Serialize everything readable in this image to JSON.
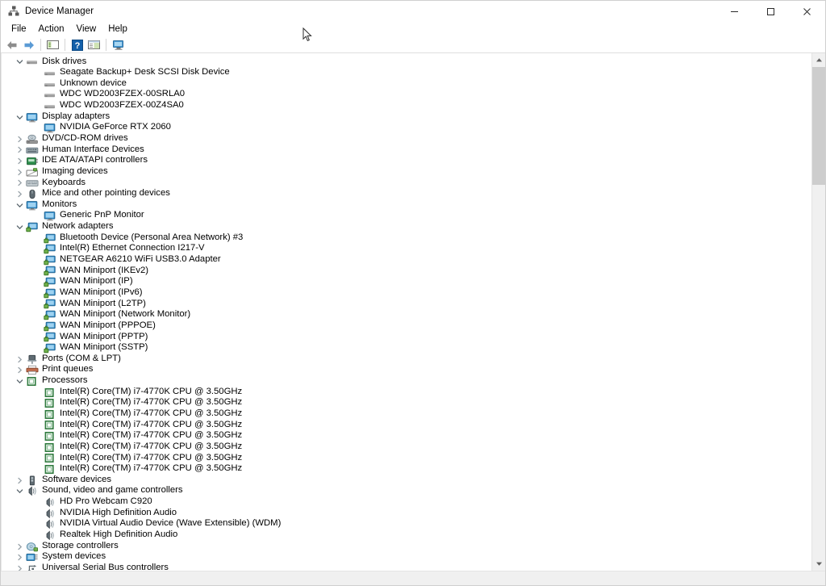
{
  "window": {
    "title": "Device Manager",
    "app_icon": "device-manager-icon",
    "controls": {
      "minimize": "─",
      "maximize": "☐",
      "close": "✕"
    }
  },
  "menubar": {
    "items": [
      {
        "label": "File"
      },
      {
        "label": "Action"
      },
      {
        "label": "View"
      },
      {
        "label": "Help"
      }
    ]
  },
  "toolbar": {
    "buttons": [
      {
        "name": "back-arrow-icon",
        "tooltip": "Back"
      },
      {
        "name": "forward-arrow-icon",
        "tooltip": "Forward"
      },
      {
        "name": "separator-1"
      },
      {
        "name": "show-hide-console-tree-icon",
        "tooltip": "Show/Hide Console Tree"
      },
      {
        "name": "separator-2"
      },
      {
        "name": "help-icon",
        "tooltip": "Help"
      },
      {
        "name": "properties-icon",
        "tooltip": "Properties"
      },
      {
        "name": "separator-3"
      },
      {
        "name": "scan-for-hardware-changes-icon",
        "tooltip": "Scan for hardware changes"
      }
    ]
  },
  "scrollbar": {
    "up_arrow": "▲",
    "down_arrow": "▼",
    "thumb_top_pct": 0,
    "thumb_height_pct": 24
  },
  "tree": [
    {
      "depth": 0,
      "state": "expanded",
      "icon": "disk-drive-icon",
      "label": "Disk drives"
    },
    {
      "depth": 1,
      "state": "leaf",
      "icon": "disk-drive-icon",
      "label": "Seagate Backup+  Desk SCSI Disk Device"
    },
    {
      "depth": 1,
      "state": "leaf",
      "icon": "disk-drive-icon",
      "label": "Unknown device"
    },
    {
      "depth": 1,
      "state": "leaf",
      "icon": "disk-drive-icon",
      "label": "WDC WD2003FZEX-00SRLA0"
    },
    {
      "depth": 1,
      "state": "leaf",
      "icon": "disk-drive-icon",
      "label": "WDC WD2003FZEX-00Z4SA0"
    },
    {
      "depth": 0,
      "state": "expanded",
      "icon": "display-adapter-icon",
      "label": "Display adapters"
    },
    {
      "depth": 1,
      "state": "leaf",
      "icon": "display-adapter-icon",
      "label": "NVIDIA GeForce RTX 2060"
    },
    {
      "depth": 0,
      "state": "collapsed",
      "icon": "dvd-drive-icon",
      "label": "DVD/CD-ROM drives"
    },
    {
      "depth": 0,
      "state": "collapsed",
      "icon": "hid-icon",
      "label": "Human Interface Devices"
    },
    {
      "depth": 0,
      "state": "collapsed",
      "icon": "ide-controller-icon",
      "label": "IDE ATA/ATAPI controllers"
    },
    {
      "depth": 0,
      "state": "collapsed",
      "icon": "imaging-device-icon",
      "label": "Imaging devices"
    },
    {
      "depth": 0,
      "state": "collapsed",
      "icon": "keyboard-icon",
      "label": "Keyboards"
    },
    {
      "depth": 0,
      "state": "collapsed",
      "icon": "mouse-icon",
      "label": "Mice and other pointing devices"
    },
    {
      "depth": 0,
      "state": "expanded",
      "icon": "monitor-icon",
      "label": "Monitors"
    },
    {
      "depth": 1,
      "state": "leaf",
      "icon": "monitor-icon",
      "label": "Generic PnP Monitor"
    },
    {
      "depth": 0,
      "state": "expanded",
      "icon": "network-adapter-icon",
      "label": "Network adapters"
    },
    {
      "depth": 1,
      "state": "leaf",
      "icon": "network-adapter-icon",
      "label": "Bluetooth Device (Personal Area Network) #3"
    },
    {
      "depth": 1,
      "state": "leaf",
      "icon": "network-adapter-icon",
      "label": "Intel(R) Ethernet Connection I217-V"
    },
    {
      "depth": 1,
      "state": "leaf",
      "icon": "network-adapter-icon",
      "label": "NETGEAR A6210 WiFi USB3.0 Adapter"
    },
    {
      "depth": 1,
      "state": "leaf",
      "icon": "network-adapter-icon",
      "label": "WAN Miniport (IKEv2)"
    },
    {
      "depth": 1,
      "state": "leaf",
      "icon": "network-adapter-icon",
      "label": "WAN Miniport (IP)"
    },
    {
      "depth": 1,
      "state": "leaf",
      "icon": "network-adapter-icon",
      "label": "WAN Miniport (IPv6)"
    },
    {
      "depth": 1,
      "state": "leaf",
      "icon": "network-adapter-icon",
      "label": "WAN Miniport (L2TP)"
    },
    {
      "depth": 1,
      "state": "leaf",
      "icon": "network-adapter-icon",
      "label": "WAN Miniport (Network Monitor)"
    },
    {
      "depth": 1,
      "state": "leaf",
      "icon": "network-adapter-icon",
      "label": "WAN Miniport (PPPOE)"
    },
    {
      "depth": 1,
      "state": "leaf",
      "icon": "network-adapter-icon",
      "label": "WAN Miniport (PPTP)"
    },
    {
      "depth": 1,
      "state": "leaf",
      "icon": "network-adapter-icon",
      "label": "WAN Miniport (SSTP)"
    },
    {
      "depth": 0,
      "state": "collapsed",
      "icon": "port-icon",
      "label": "Ports (COM & LPT)"
    },
    {
      "depth": 0,
      "state": "collapsed",
      "icon": "print-queue-icon",
      "label": "Print queues"
    },
    {
      "depth": 0,
      "state": "expanded",
      "icon": "processor-icon",
      "label": "Processors"
    },
    {
      "depth": 1,
      "state": "leaf",
      "icon": "processor-icon",
      "label": "Intel(R) Core(TM) i7-4770K CPU @ 3.50GHz"
    },
    {
      "depth": 1,
      "state": "leaf",
      "icon": "processor-icon",
      "label": "Intel(R) Core(TM) i7-4770K CPU @ 3.50GHz"
    },
    {
      "depth": 1,
      "state": "leaf",
      "icon": "processor-icon",
      "label": "Intel(R) Core(TM) i7-4770K CPU @ 3.50GHz"
    },
    {
      "depth": 1,
      "state": "leaf",
      "icon": "processor-icon",
      "label": "Intel(R) Core(TM) i7-4770K CPU @ 3.50GHz"
    },
    {
      "depth": 1,
      "state": "leaf",
      "icon": "processor-icon",
      "label": "Intel(R) Core(TM) i7-4770K CPU @ 3.50GHz"
    },
    {
      "depth": 1,
      "state": "leaf",
      "icon": "processor-icon",
      "label": "Intel(R) Core(TM) i7-4770K CPU @ 3.50GHz"
    },
    {
      "depth": 1,
      "state": "leaf",
      "icon": "processor-icon",
      "label": "Intel(R) Core(TM) i7-4770K CPU @ 3.50GHz"
    },
    {
      "depth": 1,
      "state": "leaf",
      "icon": "processor-icon",
      "label": "Intel(R) Core(TM) i7-4770K CPU @ 3.50GHz"
    },
    {
      "depth": 0,
      "state": "collapsed",
      "icon": "software-device-icon",
      "label": "Software devices"
    },
    {
      "depth": 0,
      "state": "expanded",
      "icon": "sound-icon",
      "label": "Sound, video and game controllers"
    },
    {
      "depth": 1,
      "state": "leaf",
      "icon": "sound-icon",
      "label": "HD Pro Webcam C920"
    },
    {
      "depth": 1,
      "state": "leaf",
      "icon": "sound-icon",
      "label": "NVIDIA High Definition Audio"
    },
    {
      "depth": 1,
      "state": "leaf",
      "icon": "sound-icon",
      "label": "NVIDIA Virtual Audio Device (Wave Extensible) (WDM)"
    },
    {
      "depth": 1,
      "state": "leaf",
      "icon": "sound-icon",
      "label": "Realtek High Definition Audio"
    },
    {
      "depth": 0,
      "state": "collapsed",
      "icon": "storage-controller-icon",
      "label": "Storage controllers"
    },
    {
      "depth": 0,
      "state": "collapsed",
      "icon": "system-device-icon",
      "label": "System devices"
    },
    {
      "depth": 0,
      "state": "collapsed",
      "icon": "usb-controller-icon",
      "label": "Universal Serial Bus controllers"
    }
  ],
  "colors": {
    "accent_blue": "#3a95d4",
    "icon_gray": "#8d8d8d",
    "processor_green": "#2f7a3e",
    "window_bg": "#ffffff",
    "scrollbar_track": "#f0f0f0",
    "scrollbar_thumb": "#cdcdcd"
  }
}
